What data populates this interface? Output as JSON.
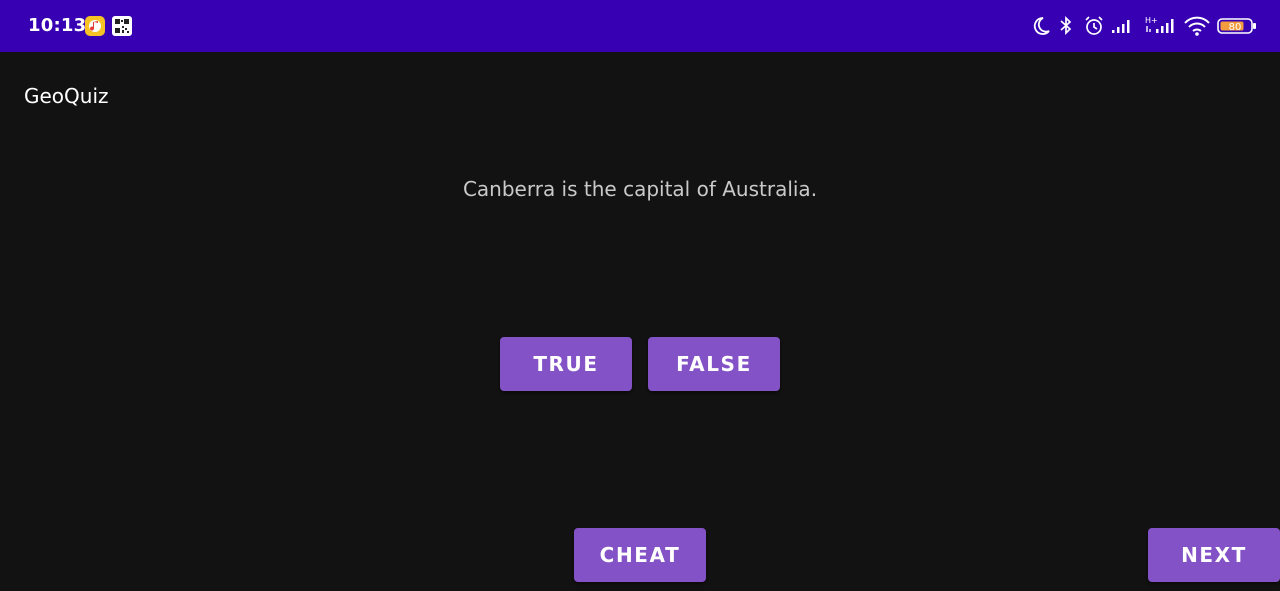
{
  "status_bar": {
    "time": "10:13",
    "background_color": "#3700b3",
    "notification_icons": [
      "music-app-icon",
      "qr-code-icon"
    ],
    "system_icons": [
      "moon-icon",
      "bluetooth-icon",
      "alarm-icon",
      "signal-icon",
      "signal-hplus-icon",
      "wifi-icon",
      "battery-icon"
    ],
    "battery_level": "80"
  },
  "app": {
    "title": "GeoQuiz"
  },
  "question": {
    "text": "Canberra is the capital of Australia."
  },
  "buttons": {
    "true_label": "TRUE",
    "false_label": "FALSE",
    "cheat_label": "CHEAT",
    "next_label": "NEXT",
    "color": "#8352c6"
  },
  "theme": {
    "background": "#121212",
    "text_secondary": "#c9c9c9"
  }
}
